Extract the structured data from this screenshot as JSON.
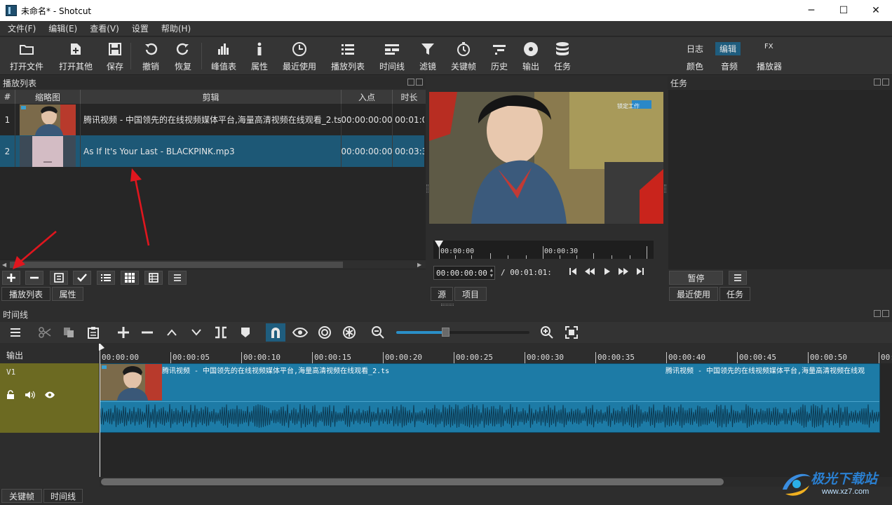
{
  "window": {
    "title": "未命名* - Shotcut",
    "minimize": "─",
    "maximize": "☐",
    "close": "✕"
  },
  "menu": [
    "文件(F)",
    "编辑(E)",
    "查看(V)",
    "设置",
    "帮助(H)"
  ],
  "toolbar": {
    "open_file": "打开文件",
    "open_other": "打开其他",
    "save": "保存",
    "undo": "撤销",
    "redo": "恢复",
    "peak_meter": "峰值表",
    "properties": "属性",
    "recent": "最近使用",
    "playlist": "播放列表",
    "timeline": "时间线",
    "filters": "滤镜",
    "keyframes": "关键帧",
    "history": "历史",
    "export": "输出",
    "jobs": "任务"
  },
  "layouts": {
    "log": "日志",
    "edit": "编辑",
    "fx": "FX",
    "color": "颜色",
    "audio": "音频",
    "player": "播放器"
  },
  "playlist": {
    "title": "播放列表",
    "columns": [
      "#",
      "缩略图",
      "剪辑",
      "入点",
      "时长"
    ],
    "rows": [
      {
        "num": "1",
        "name": "腾讯视频 - 中国领先的在线视频媒体平台,海量高清视频在线观看_2.ts",
        "in": "00:00:00:00",
        "duration": "00:01:0"
      },
      {
        "num": "2",
        "name": "As If It's Your Last - BLACKPINK.mp3",
        "in": "00:00:00:00",
        "duration": "00:03:3"
      }
    ],
    "tabs": {
      "playlist": "播放列表",
      "properties": "属性"
    }
  },
  "player": {
    "overlay_logo": "锁定工作",
    "ruler_labels": [
      "00:00:00",
      "00:00:30"
    ],
    "current_time": "00:00:00:00",
    "total_time": "/ 00:01:01:",
    "tabs": {
      "source": "源",
      "project": "项目"
    }
  },
  "jobs": {
    "title": "任务",
    "pause": "暂停",
    "tabs": {
      "recent": "最近使用",
      "jobs": "任务"
    }
  },
  "timeline": {
    "title": "时间线",
    "output_label": "输出",
    "track_v1": "V1",
    "ruler_labels": [
      "00:00:00",
      "00:00:05",
      "00:00:10",
      "00:00:15",
      "00:00:20",
      "00:00:25",
      "00:00:30",
      "00:00:35",
      "00:00:40",
      "00:00:45",
      "00:00:50",
      "00:00:5"
    ],
    "clip_label": "腾讯视频 - 中国领先的在线视频媒体平台,海量高清视频在线观看_2.ts",
    "clip_label_2": "腾讯视频 - 中国领先的在线视频媒体平台,海量高清视频在线观",
    "zoom_level": 0.37
  },
  "bottom_tabs": {
    "keyframes": "关键帧",
    "timeline": "时间线"
  },
  "watermark": {
    "text": "极光下载站",
    "url": "www.xz7.com"
  },
  "colors": {
    "accent": "#1d5876",
    "clip": "#1d7ba6",
    "track_head": "#6c6a22",
    "arrow": "#e0161e"
  }
}
